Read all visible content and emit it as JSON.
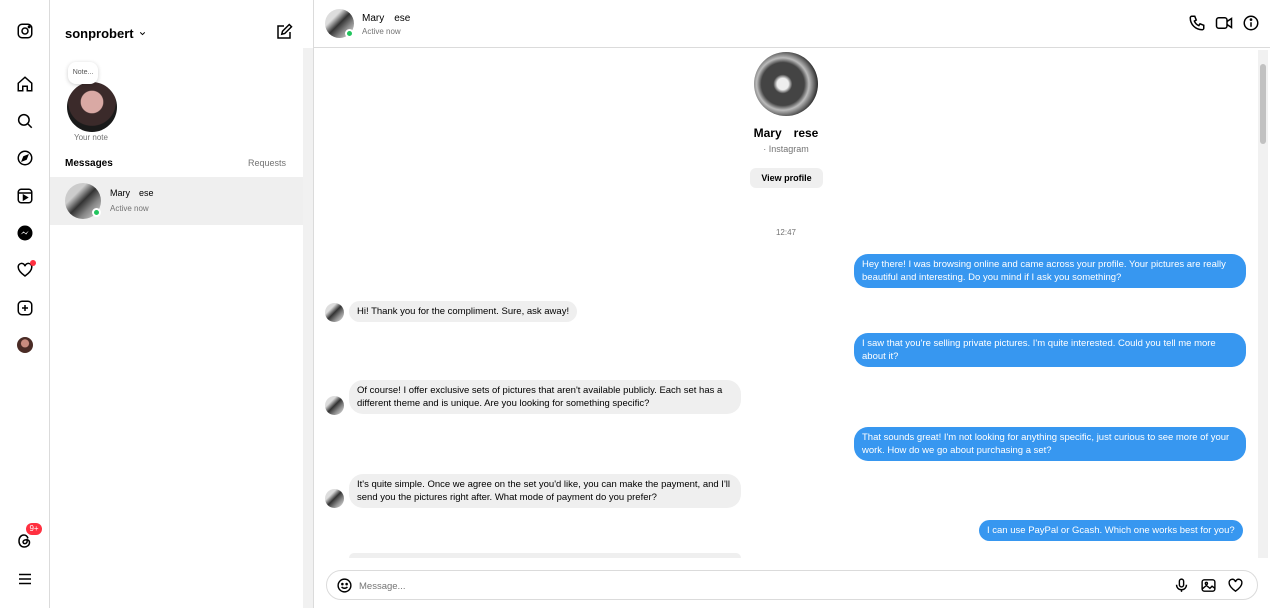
{
  "sidebar": {
    "username": "sonprobert",
    "note_text": "Note...",
    "note_label": "Your note",
    "messages_heading": "Messages",
    "requests_label": "Requests",
    "threads_badge": "9+",
    "conversations": [
      {
        "name": "Mary  ese",
        "status": "Active now"
      }
    ]
  },
  "header": {
    "name": "Mary  ese",
    "status": "Active now"
  },
  "profile": {
    "name": "Mary  rese",
    "subtitle": "· Instagram",
    "view_profile": "View profile"
  },
  "timestamp": "12:47",
  "messages": [
    {
      "from": "me",
      "text": "Hey there! I was browsing online and came across your profile. Your pictures are really beautiful and interesting. Do you mind if I ask you something?"
    },
    {
      "from": "them",
      "text": "Hi! Thank you for the compliment. Sure, ask away!"
    },
    {
      "from": "me",
      "text": "I saw that you're selling private pictures. I'm quite interested. Could you tell me more about it?"
    },
    {
      "from": "them",
      "text": "Of course! I offer exclusive sets of pictures that aren't available publicly. Each set has a different theme and is unique. Are you looking for something specific?"
    },
    {
      "from": "me",
      "text": "That sounds great! I'm not looking for anything specific, just curious to see more of your work. How do we go about purchasing a set?"
    },
    {
      "from": "them",
      "text": "It's quite simple. Once we agree on the set you'd like, you can make the payment, and I'll send you the pictures right after. What mode of payment do you prefer?"
    },
    {
      "from": "me",
      "text": "I can use PayPal or Gcash. Which one works best for you?"
    }
  ],
  "composer": {
    "placeholder": "Message..."
  },
  "icons": {
    "rail": [
      "instagram-icon",
      "home-icon",
      "search-icon",
      "explore-icon",
      "reels-icon",
      "messenger-icon",
      "heart-icon",
      "create-icon",
      "profile-avatar",
      "threads-icon",
      "menu-icon"
    ],
    "header": [
      "phone-icon",
      "video-icon",
      "info-icon"
    ],
    "composer": [
      "emoji-icon",
      "microphone-icon",
      "image-icon",
      "heart-icon"
    ]
  },
  "colors": {
    "outgoing_bubble": "#3797f0",
    "incoming_bubble": "#efefef",
    "online": "#22c55e",
    "notification": "#ff3040"
  }
}
